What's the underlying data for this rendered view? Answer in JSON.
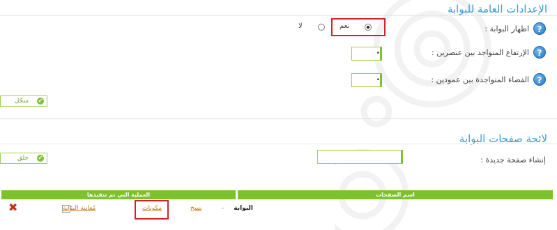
{
  "general_settings": {
    "title": "الإعدادات العامة للبوابة",
    "show_portal_label": "اظهار البوابة :",
    "yes_label": "نعم",
    "no_label": "لا",
    "yes_selected": true,
    "height_between_elements_label": "الإرتفاع المتواجد بين عنصرين :",
    "height_between_elements_value": "•",
    "space_between_columns_label": "الفضاء المتواجدة بين عمودين :",
    "space_between_columns_value": "•",
    "save_button_label": "سجّل"
  },
  "portal_pages": {
    "title": "لائحة صفحات البوابة",
    "create_page_label": "إنشاء صفحة جديدة :",
    "create_page_value": "",
    "create_button_label": "خلق",
    "table": {
      "columns": [
        "اسم الصفحات",
        "العملية التي تم تنفيذها"
      ],
      "rows": [
        {
          "page_name": "البوابة",
          "dash": "-",
          "copy": "نسخ",
          "components": "مكونات",
          "preview": "مُعاينة البوّابة"
        }
      ]
    }
  },
  "colors": {
    "accent_blue": "#3f9bd3",
    "accent_green": "#7cc22c",
    "highlight_red": "#d0232b",
    "delete_red": "#c2331a"
  }
}
